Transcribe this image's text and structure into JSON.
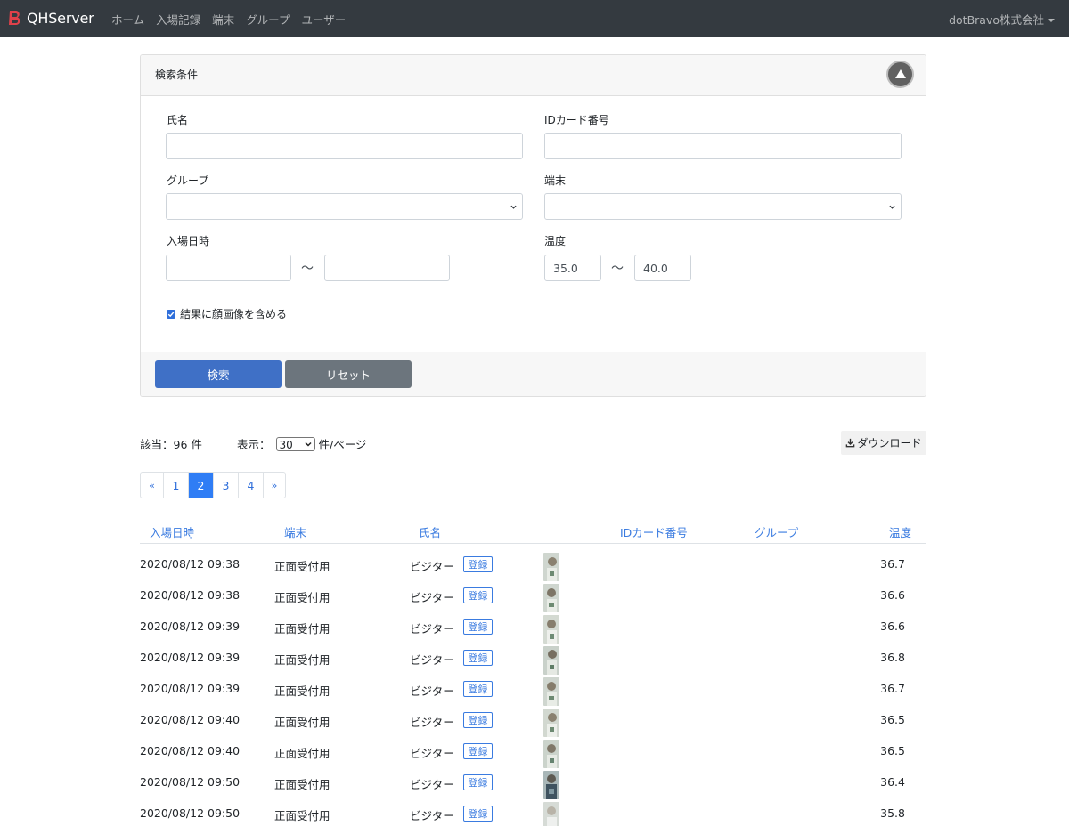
{
  "navbar": {
    "brand": "QHServer",
    "links": [
      "ホーム",
      "入場記録",
      "端末",
      "グループ",
      "ユーザー"
    ],
    "user": "dotBravo株式会社"
  },
  "search": {
    "title": "検索条件",
    "name_label": "氏名",
    "name_value": "",
    "idcard_label": "IDカード番号",
    "idcard_value": "",
    "group_label": "グループ",
    "group_value": "",
    "terminal_label": "端末",
    "terminal_value": "",
    "entry_label": "入場日時",
    "entry_from": "",
    "entry_to": "",
    "temp_label": "温度",
    "temp_from": "35.0",
    "temp_to": "40.0",
    "range_sep": "〜",
    "include_face_label": "結果に顔画像を含める",
    "include_face_checked": true,
    "search_button": "検索",
    "reset_button": "リセット"
  },
  "results": {
    "count_text": "該当：96 件",
    "per_page_label": "表示：",
    "per_page_value": "30",
    "per_page_suffix": "件/ページ",
    "download_label": "ダウンロード"
  },
  "pagination": {
    "prev": "«",
    "pages": [
      "1",
      "2",
      "3",
      "4"
    ],
    "active": "2",
    "next": "»"
  },
  "table": {
    "headers": [
      "入場日時",
      "端末",
      "氏名",
      "IDカード番号",
      "グループ",
      "温度"
    ],
    "register_label": "登録",
    "rows": [
      {
        "datetime": "2020/08/12 09:38",
        "terminal": "正面受付用",
        "name": "ビジター",
        "temp": "36.7"
      },
      {
        "datetime": "2020/08/12 09:38",
        "terminal": "正面受付用",
        "name": "ビジター",
        "temp": "36.6"
      },
      {
        "datetime": "2020/08/12 09:39",
        "terminal": "正面受付用",
        "name": "ビジター",
        "temp": "36.6"
      },
      {
        "datetime": "2020/08/12 09:39",
        "terminal": "正面受付用",
        "name": "ビジター",
        "temp": "36.8"
      },
      {
        "datetime": "2020/08/12 09:39",
        "terminal": "正面受付用",
        "name": "ビジター",
        "temp": "36.7"
      },
      {
        "datetime": "2020/08/12 09:40",
        "terminal": "正面受付用",
        "name": "ビジター",
        "temp": "36.5"
      },
      {
        "datetime": "2020/08/12 09:40",
        "terminal": "正面受付用",
        "name": "ビジター",
        "temp": "36.5"
      },
      {
        "datetime": "2020/08/12 09:50",
        "terminal": "正面受付用",
        "name": "ビジター",
        "temp": "36.4"
      },
      {
        "datetime": "2020/08/12 09:50",
        "terminal": "正面受付用",
        "name": "ビジター",
        "temp": "35.8"
      }
    ]
  },
  "colors": {
    "navbar_bg": "#343a40",
    "primary": "#3f70c6",
    "secondary": "#6c757d",
    "link": "#3a7be0",
    "brand_logo": "#e0414a"
  },
  "icons": {
    "brand": "bravo-logo-icon",
    "collapse": "collapse-up-icon",
    "download": "download-icon",
    "select": "chevron-down-icon",
    "checkbox": "check-icon",
    "thumbnail": "face-thumbnail-icon"
  }
}
